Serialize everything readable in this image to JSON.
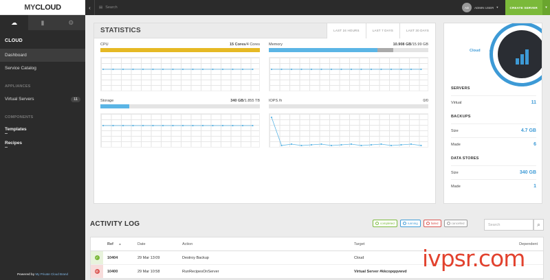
{
  "brand": {
    "logo_a": "MY",
    "logo_b": "CLOUD"
  },
  "topbar": {
    "search_placeholder": "Search",
    "user_initials": "AD",
    "user_label": "ADMIN USER",
    "create_button": "CREATE SERVER"
  },
  "sidebar": {
    "section": "CLOUD",
    "items": [
      {
        "label": "Dashboard"
      },
      {
        "label": "Service Catalog"
      }
    ],
    "appliances_header": "APPLIANCES",
    "virtual_servers": {
      "label": "Virtual Servers",
      "count": "11"
    },
    "components_header": "COMPONENTS",
    "links": [
      {
        "label": "Templates"
      },
      {
        "label": "Recipes"
      }
    ],
    "footer_prefix": "Powered by",
    "footer_brand": "My Private Cloud Brand"
  },
  "statistics": {
    "title": "STATISTICS",
    "periods": [
      "LAST 24 HOURS",
      "LAST 7 DAYS",
      "LAST 30 DAYS"
    ],
    "metrics": [
      {
        "label": "CPU",
        "value_bold": "15 Cores",
        "value_rest": "/4 Cores",
        "usage_fraction": 1.0,
        "color": "#e6b924"
      },
      {
        "label": "Memory",
        "value_bold": "10.908 GB",
        "value_rest": "/15.99 GB",
        "usage_fraction": 0.68,
        "extra_fraction": 0.1,
        "color": "#5bb5e5"
      },
      {
        "label": "Storage",
        "value_bold": "340 GB",
        "value_rest": "/1.855 TB",
        "usage_fraction": 0.18,
        "color": "#5bb5e5"
      },
      {
        "label": "IOPS /h",
        "value_bold": "",
        "value_rest": "0/0",
        "usage_fraction": 0.0,
        "color": "#5bb5e5"
      }
    ]
  },
  "overview": {
    "cloud_label": "Cloud",
    "servers": {
      "title": "SERVERS",
      "rows": [
        {
          "label": "Virtual",
          "value": "11"
        }
      ]
    },
    "backups": {
      "title": "BACKUPS",
      "rows": [
        {
          "label": "Size",
          "value": "4.7 GB"
        },
        {
          "label": "Made",
          "value": "6"
        }
      ]
    },
    "datastores": {
      "title": "DATA STORES",
      "rows": [
        {
          "label": "Size",
          "value": "340 GB"
        },
        {
          "label": "Made",
          "value": "1"
        }
      ]
    }
  },
  "activity": {
    "title": "ACTIVITY LOG",
    "filters": [
      {
        "label": "completed",
        "color": "#7bb93a"
      },
      {
        "label": "running",
        "color": "#3d9ad6"
      },
      {
        "label": "failed",
        "color": "#d9534f"
      },
      {
        "label": "cancelled",
        "color": "#999999"
      }
    ],
    "search_placeholder": "Search",
    "columns": {
      "ref": "Ref",
      "date": "Date",
      "action": "Action",
      "target": "Target",
      "dependent": "Dependent"
    },
    "rows": [
      {
        "status": "completed",
        "status_color": "#7bb93a",
        "row_color": "#e8f3dc",
        "ref": "10404",
        "date": "29 Mar 13:09",
        "action": "Destroy Backup",
        "target": "Cloud",
        "target_bold": false
      },
      {
        "status": "failed",
        "status_color": "#d9534f",
        "row_color": "#f7dcdb",
        "ref": "10400",
        "date": "29 Mar 10:58",
        "action": "RunRecipesOnServer",
        "target": "Virtual Server #kkcopqqvwvd",
        "target_bold": true
      }
    ]
  },
  "watermark": "ivpsr.com"
}
